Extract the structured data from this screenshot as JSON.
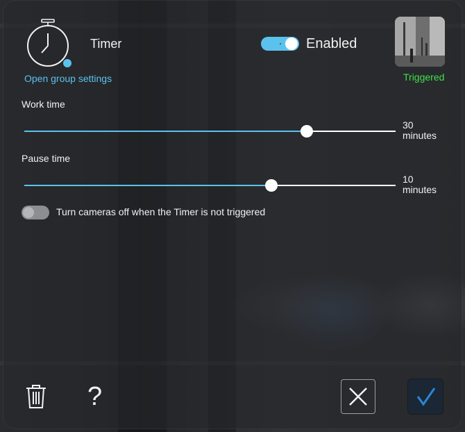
{
  "header": {
    "title": "Timer",
    "group_settings_link": "Open group settings",
    "enabled_label": "Enabled",
    "enabled": true,
    "status_text": "Triggered",
    "status_color": "#3fe24a",
    "icon": "stopwatch-icon",
    "thumbnail": "camera-thumbnail"
  },
  "settings": {
    "work_time": {
      "label": "Work time",
      "value": "30",
      "unit": "minutes",
      "fraction": 0.76
    },
    "pause_time": {
      "label": "Pause time",
      "value": "10",
      "unit": "minutes",
      "fraction": 0.665
    },
    "cameras_off": {
      "label": "Turn cameras off when the Timer is not triggered",
      "enabled": false
    }
  },
  "footer": {
    "delete_icon": "trash-icon",
    "help_icon": "?",
    "cancel_icon": "close-icon",
    "confirm_icon": "checkmark-icon"
  },
  "colors": {
    "accent": "#5bc2ee",
    "triggered": "#3fe24a",
    "confirm_check": "#2a86d8"
  }
}
